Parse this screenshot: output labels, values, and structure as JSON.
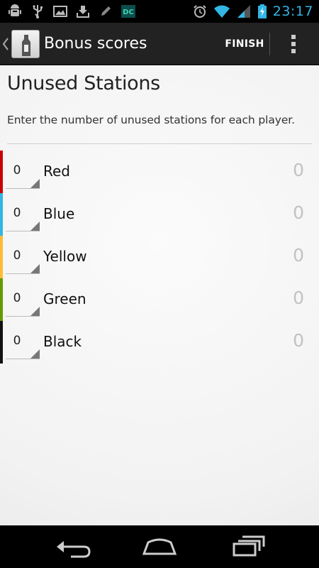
{
  "status_bar": {
    "time": "23:17",
    "notification_icons": [
      "android-debug-icon",
      "usb-icon",
      "image-icon",
      "download-icon",
      "pencil-icon",
      "dc-app-icon"
    ],
    "system_icons": [
      "alarm-icon",
      "wifi-icon",
      "signal-icon",
      "battery-charging-icon"
    ]
  },
  "action_bar": {
    "title": "Bonus scores",
    "finish_label": "FINISH"
  },
  "page": {
    "title": "Unused Stations",
    "instructions": "Enter the number of unused stations for each player."
  },
  "players": [
    {
      "name": "Red",
      "count": "0",
      "score": "0",
      "color": "#cc0000"
    },
    {
      "name": "Blue",
      "count": "0",
      "score": "0",
      "color": "#33b5e5"
    },
    {
      "name": "Yellow",
      "count": "0",
      "score": "0",
      "color": "#ffbb33"
    },
    {
      "name": "Green",
      "count": "0",
      "score": "0",
      "color": "#669900"
    },
    {
      "name": "Black",
      "count": "0",
      "score": "0",
      "color": "#111111"
    }
  ],
  "colors": {
    "accent": "#33b5e5",
    "action_bar": "#222222"
  },
  "nav_bar": {
    "icons": [
      "back-icon",
      "home-icon",
      "recent-apps-icon"
    ]
  }
}
